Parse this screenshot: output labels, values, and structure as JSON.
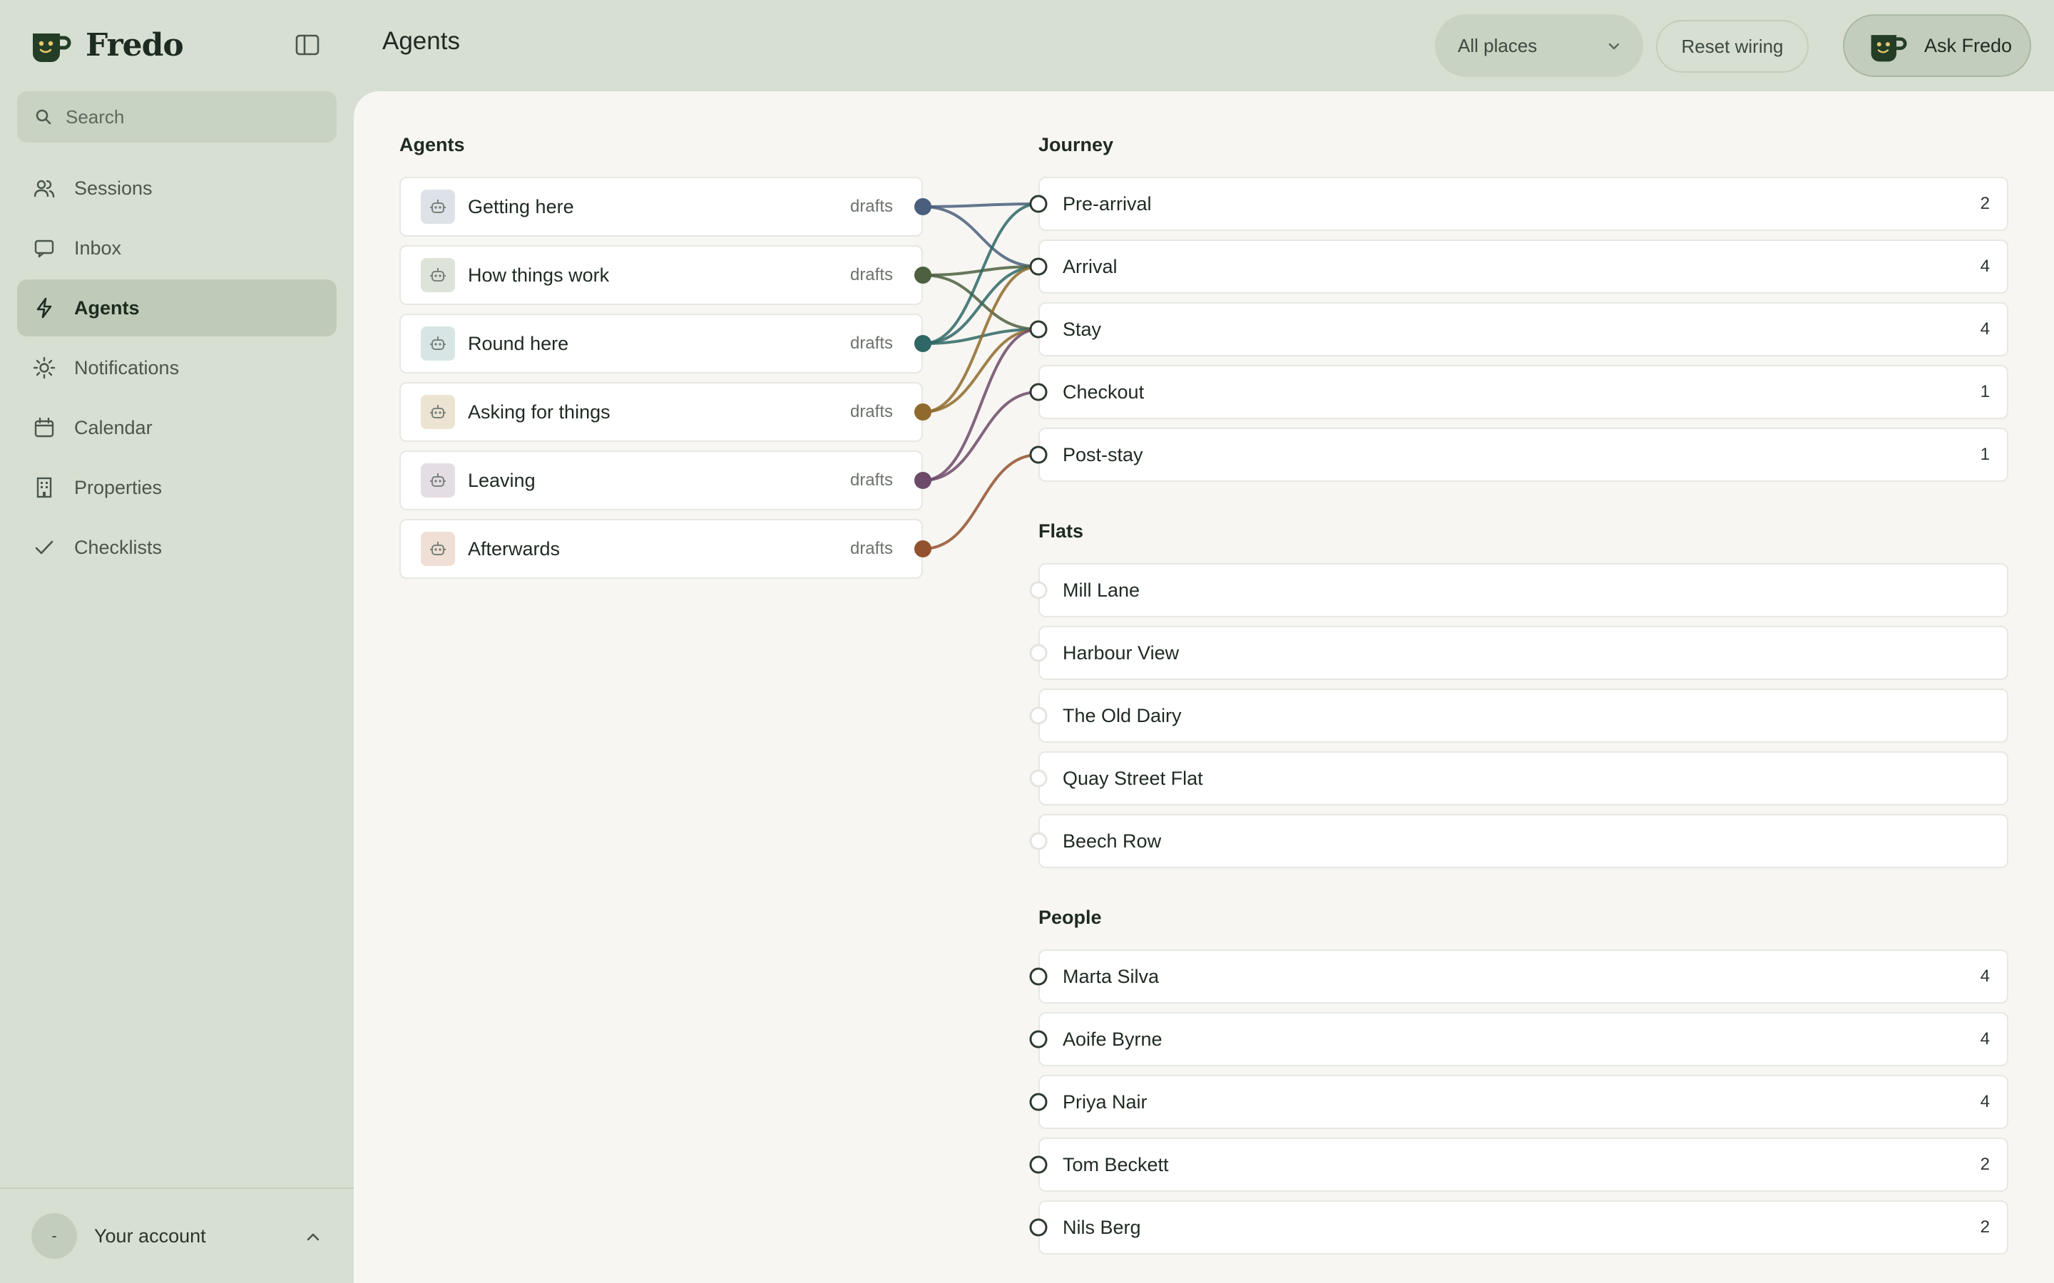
{
  "app": {
    "brand": "Fredo",
    "page_title": "Agents"
  },
  "search": {
    "placeholder": "Search"
  },
  "nav": {
    "items": [
      {
        "key": "sessions",
        "label": "Sessions",
        "icon": "users-icon",
        "active": false
      },
      {
        "key": "inbox",
        "label": "Inbox",
        "icon": "chat-bubble-icon",
        "active": false
      },
      {
        "key": "agents",
        "label": "Agents",
        "icon": "lightning-icon",
        "active": true
      },
      {
        "key": "notifications",
        "label": "Notifications",
        "icon": "sun-icon",
        "active": false
      },
      {
        "key": "calendar",
        "label": "Calendar",
        "icon": "calendar-icon",
        "active": false
      },
      {
        "key": "properties",
        "label": "Properties",
        "icon": "building-icon",
        "active": false
      },
      {
        "key": "checklists",
        "label": "Checklists",
        "icon": "check-icon",
        "active": false
      }
    ]
  },
  "account": {
    "avatar_text": "-",
    "label": "Your account"
  },
  "header": {
    "places_value": "All places",
    "reset_label": "Reset wiring",
    "ask_label": "Ask Fredo"
  },
  "agents_section": {
    "title": "Agents",
    "items": [
      {
        "label": "Getting here",
        "status": "drafts",
        "color": "#4a5f7d",
        "icon_bg": "#dde2e8"
      },
      {
        "label": "How things work",
        "status": "drafts",
        "color": "#4d6040",
        "icon_bg": "#dde3d8"
      },
      {
        "label": "Round here",
        "status": "drafts",
        "color": "#2e6766",
        "icon_bg": "#d7e6e4"
      },
      {
        "label": "Asking for things",
        "status": "drafts",
        "color": "#8f6a2c",
        "icon_bg": "#ece3d2"
      },
      {
        "label": "Leaving",
        "status": "drafts",
        "color": "#6d4a6a",
        "icon_bg": "#e5dde4"
      },
      {
        "label": "Afterwards",
        "status": "drafts",
        "color": "#93522f",
        "icon_bg": "#f0dfd5"
      }
    ]
  },
  "journey": {
    "title": "Journey",
    "items": [
      {
        "label": "Pre-arrival",
        "count": "2"
      },
      {
        "label": "Arrival",
        "count": "4"
      },
      {
        "label": "Stay",
        "count": "4"
      },
      {
        "label": "Checkout",
        "count": "1"
      },
      {
        "label": "Post-stay",
        "count": "1"
      }
    ]
  },
  "flats": {
    "title": "Flats",
    "items": [
      {
        "label": "Mill Lane"
      },
      {
        "label": "Harbour View"
      },
      {
        "label": "The Old Dairy"
      },
      {
        "label": "Quay Street Flat"
      },
      {
        "label": "Beech Row"
      }
    ]
  },
  "people": {
    "title": "People",
    "items": [
      {
        "label": "Marta Silva",
        "count": "4"
      },
      {
        "label": "Aoife Byrne",
        "count": "4"
      },
      {
        "label": "Priya Nair",
        "count": "4"
      },
      {
        "label": "Tom Beckett",
        "count": "2"
      },
      {
        "label": "Nils Berg",
        "count": "2"
      }
    ]
  },
  "wiring": [
    {
      "agent": 0,
      "journey": 0
    },
    {
      "agent": 0,
      "journey": 1
    },
    {
      "agent": 1,
      "journey": 1
    },
    {
      "agent": 1,
      "journey": 2
    },
    {
      "agent": 2,
      "journey": 0
    },
    {
      "agent": 2,
      "journey": 1
    },
    {
      "agent": 2,
      "journey": 2
    },
    {
      "agent": 3,
      "journey": 1
    },
    {
      "agent": 3,
      "journey": 2
    },
    {
      "agent": 4,
      "journey": 2
    },
    {
      "agent": 4,
      "journey": 3
    },
    {
      "agent": 5,
      "journey": 4
    }
  ]
}
